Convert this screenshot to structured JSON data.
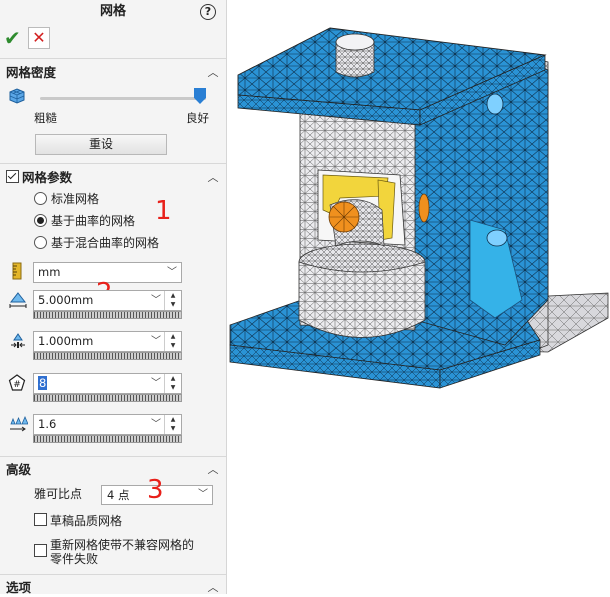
{
  "panel": {
    "title": "网格",
    "help_icon": "help-icon",
    "ok_icon": "✔",
    "cancel_icon": "✕"
  },
  "mesh_density": {
    "header": "网格密度",
    "slider_value": 1.0,
    "coarse_label": "粗糙",
    "fine_label": "良好",
    "reset_button": "重设"
  },
  "mesh_params": {
    "header": "网格参数",
    "checked": true,
    "options": [
      {
        "label": "标准网格",
        "selected": false
      },
      {
        "label": "基于曲率的网格",
        "selected": true
      },
      {
        "label": "基于混合曲率的网格",
        "selected": false
      }
    ],
    "marker_1": "1",
    "marker_2": "2",
    "unit": "mm",
    "max_element_size": "5.000mm",
    "min_element_size": "1.000mm",
    "circle_elements": "8",
    "growth_ratio": "1.6"
  },
  "advanced": {
    "header": "高级",
    "jacobian_label": "雅可比点",
    "jacobian_value": "4 点",
    "marker_3": "3",
    "draft_quality_label": "草稿品质网格",
    "remesh_label_line1": "重新网格使带不兼容网格的",
    "remesh_label_line2": "零件失败"
  },
  "options": {
    "header": "选项"
  },
  "colors": {
    "mesh_blue": "#2a93d5",
    "mesh_white": "#e9e9ec",
    "accent_yellow": "#f2d53c",
    "accent_orange": "#f0901e",
    "marker_red": "#e8201a"
  }
}
